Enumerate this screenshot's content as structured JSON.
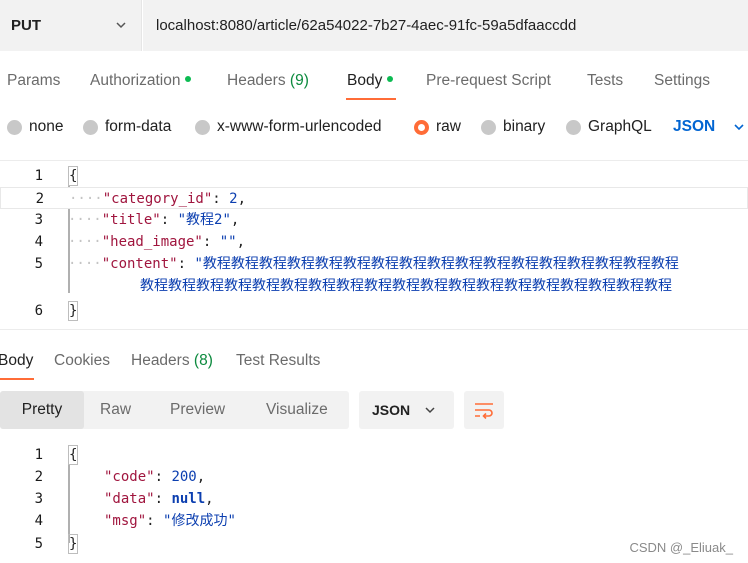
{
  "request": {
    "method": "PUT",
    "url": "localhost:8080/article/62a54022-7b27-4aec-91fc-59a5dfaaccdd"
  },
  "request_tabs": [
    {
      "label": "Params"
    },
    {
      "label": "Authorization"
    },
    {
      "label": "Headers",
      "count": "(9)"
    },
    {
      "label": "Body"
    },
    {
      "label": "Pre-request Script"
    },
    {
      "label": "Tests"
    },
    {
      "label": "Settings"
    }
  ],
  "body_types": [
    "none",
    "form-data",
    "x-www-form-urlencoded",
    "raw",
    "binary",
    "GraphQL"
  ],
  "body_format": "JSON",
  "request_body": {
    "line_numbers": [
      "1",
      "2",
      "3",
      "4",
      "5",
      "6"
    ],
    "open": "{",
    "close": "}",
    "dots2": "····",
    "k_category": "\"category_id\"",
    "v_category": "2",
    "k_title": "\"title\"",
    "v_title": "\"教程2\"",
    "k_head": "\"head_image\"",
    "v_head": "\"\"",
    "k_content": "\"content\"",
    "v_content_1": "\"教程教程教程教程教程教程教程教程教程教程教程教程教程教程教程教程教程",
    "v_content_2": "教程教程教程教程教程教程教程教程教程教程教程教程教程教程教程教程教程教程教程"
  },
  "response_tabs": [
    {
      "label": "Body"
    },
    {
      "label": "Cookies"
    },
    {
      "label": "Headers",
      "count": "(8)"
    },
    {
      "label": "Test Results"
    }
  ],
  "view_modes": [
    "Pretty",
    "Raw",
    "Preview",
    "Visualize"
  ],
  "response_format": "JSON",
  "response_body": {
    "line_numbers": [
      "1",
      "2",
      "3",
      "4",
      "5"
    ],
    "open": "{",
    "close": "}",
    "k_code": "\"code\"",
    "v_code": "200",
    "k_data": "\"data\"",
    "v_data": "null",
    "k_msg": "\"msg\"",
    "v_msg": "\"修改成功\""
  },
  "watermark": "CSDN @_Eliuak_",
  "colors": {
    "accent": "#ff6c37",
    "link_blue": "#0265d2",
    "green_dot": "#0cbb52"
  }
}
